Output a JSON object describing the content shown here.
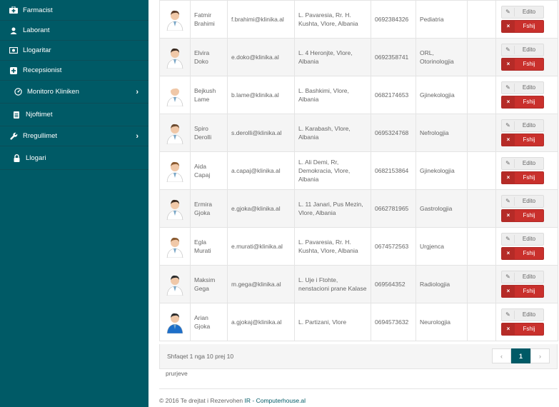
{
  "sidebar": {
    "items": [
      {
        "label": "Farmacist",
        "icon": "medkit-icon",
        "has_submenu": false
      },
      {
        "label": "Laborant",
        "icon": "user-icon",
        "has_submenu": false
      },
      {
        "label": "Llogaritar",
        "icon": "money-icon",
        "has_submenu": false
      },
      {
        "label": "Recepsionist",
        "icon": "plus-square-icon",
        "has_submenu": false
      },
      {
        "label": "Monitoro Kliniken",
        "icon": "gauge-icon",
        "has_submenu": true
      },
      {
        "label": "Njoftimet",
        "icon": "file-icon",
        "has_submenu": false
      },
      {
        "label": "Rregullimet",
        "icon": "wrench-icon",
        "has_submenu": true
      },
      {
        "label": "Llogari",
        "icon": "lock-icon",
        "has_submenu": false
      }
    ]
  },
  "table": {
    "rows": [
      {
        "name": "Fatmir Brahimi",
        "email": "f.brahimi@klinika.al",
        "address": "L. Pavaresia, Rr. H. Kushta, Vlore, Albania",
        "phone": "0692384326",
        "department": "Pediatria"
      },
      {
        "name": "Elvira Doko",
        "email": "e.doko@klinika.al",
        "address": "L. 4 Heronjte, Vlore, Albania",
        "phone": "0692358741",
        "department": "ORL, Otorinologjia"
      },
      {
        "name": "Bejkush Lame",
        "email": "b.lame@klinika.al",
        "address": "L. Bashkimi, Vlore, Albania",
        "phone": "0682174653",
        "department": "Gjinekologjia"
      },
      {
        "name": "Spiro Derolli",
        "email": "s.derolli@klinika.al",
        "address": "L. Karabash, Vlore, Albania",
        "phone": "0695324768",
        "department": "Nefrologjia"
      },
      {
        "name": "Aida Capaj",
        "email": "a.capaj@klinika.al",
        "address": "L. Ali Demi, Rr, Demokracia, Vlore, Albania",
        "phone": "0682153864",
        "department": "Gjinekologjia"
      },
      {
        "name": "Ermira Gjoka",
        "email": "e.gjoka@klinika.al",
        "address": "L. 11 Janari, Pus Mezin, Vlore, Albania",
        "phone": "0662781965",
        "department": "Gastrologjia"
      },
      {
        "name": "Egla Murati",
        "email": "e.murati@klinika.al",
        "address": "L. Pavaresia, Rr. H. Kushta, Vlore, Albania",
        "phone": "0674572563",
        "department": "Urgjenca"
      },
      {
        "name": "Maksim Gega",
        "email": "m.gega@klinika.al",
        "address": "L. Uje i Ftohte, nenstacioni prane Kalase",
        "phone": "069564352",
        "department": "Radiologjia"
      },
      {
        "name": "Arian Gjoka",
        "email": "a.gjokaj@klinika.al",
        "address": "L. Partizani, Vlore",
        "phone": "0694573632",
        "department": "Neurologjia"
      }
    ],
    "edit_label": "Edito",
    "delete_label": "Fshij"
  },
  "pagination": {
    "summary": "Shfaqet 1 nga 10 prej 10",
    "summary_suffix": "prurjeve",
    "prev": "‹",
    "current": "1",
    "next": "›"
  },
  "footer": {
    "copyright": "© 2016 Te drejtat i Rezervohen",
    "link": "IR - Computerhouse.al"
  },
  "colors": {
    "sidebar": "#005a66",
    "delete": "#c9302c",
    "accent": "#005a66"
  }
}
